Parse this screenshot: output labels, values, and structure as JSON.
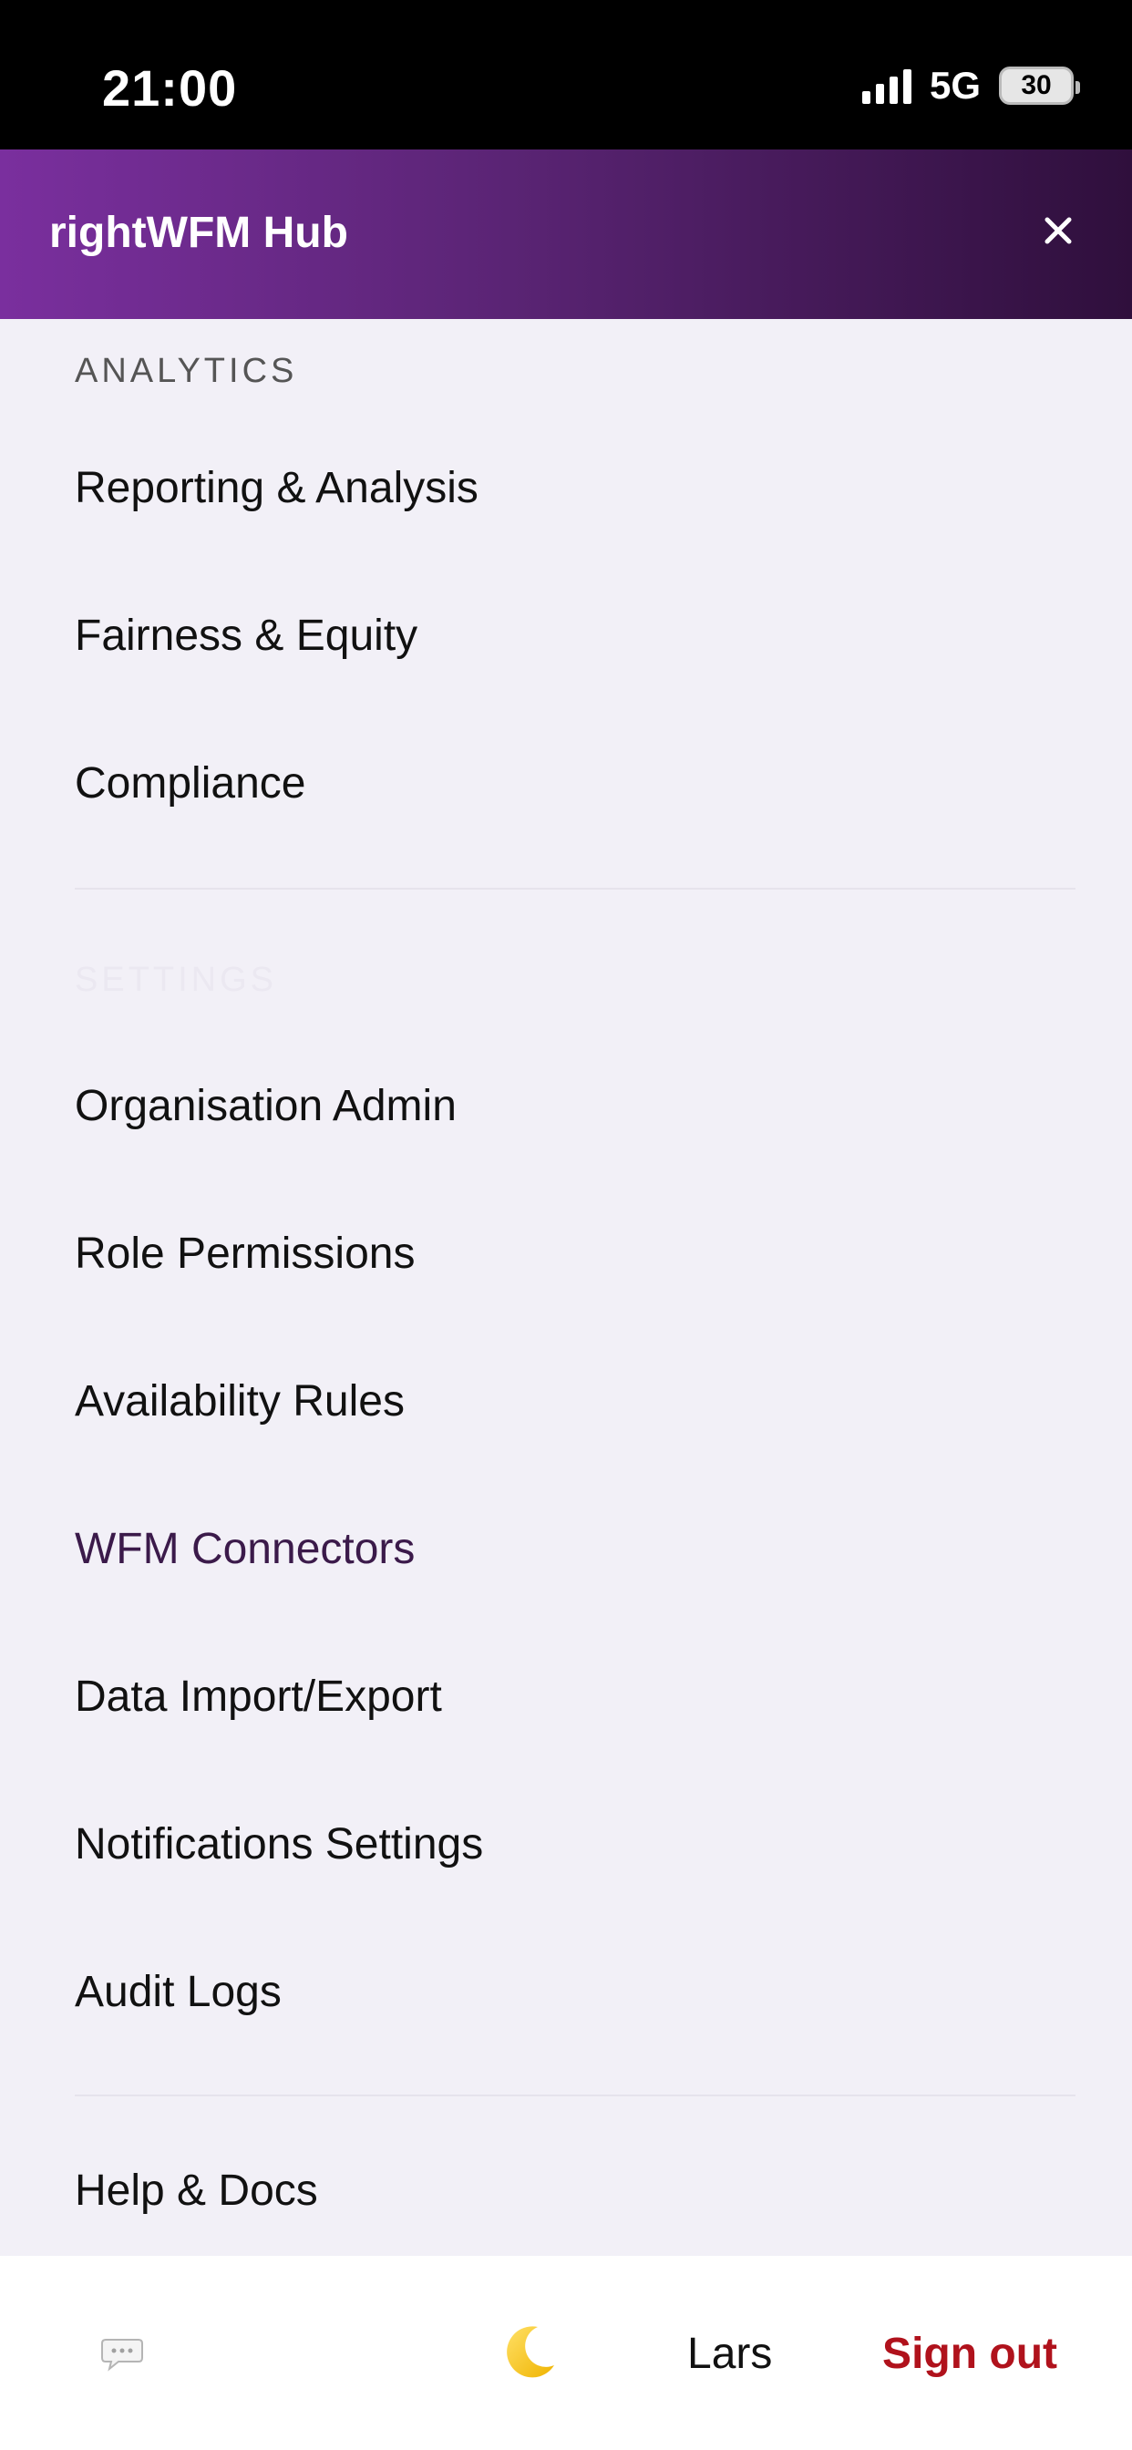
{
  "status_bar": {
    "time": "21:00",
    "network": "5G",
    "battery": "30"
  },
  "header": {
    "title": "rightWFM Hub"
  },
  "menu": {
    "analytics_label": "ANALYTICS",
    "analytics_items": [
      {
        "label": "Reporting & Analysis"
      },
      {
        "label": "Fairness & Equity"
      },
      {
        "label": "Compliance"
      }
    ],
    "settings_label": "SETTINGS",
    "settings_items": [
      {
        "label": "Organisation Admin"
      },
      {
        "label": "Role Permissions"
      },
      {
        "label": "Availability Rules"
      },
      {
        "label": "WFM Connectors"
      },
      {
        "label": "Data Import/Export"
      },
      {
        "label": "Notifications Settings"
      },
      {
        "label": "Audit Logs"
      }
    ],
    "help_item": {
      "label": "Help & Docs"
    }
  },
  "footer": {
    "chat_icon": "chat-bubble-icon",
    "theme_icon": "moon-icon",
    "user_name": "Lars",
    "sign_out_label": "Sign out"
  },
  "colors": {
    "header_gradient_start": "#7a2f9e",
    "header_gradient_end": "#2f0f3c",
    "sign_out": "#b0121c",
    "background": "#f2f0f7"
  }
}
